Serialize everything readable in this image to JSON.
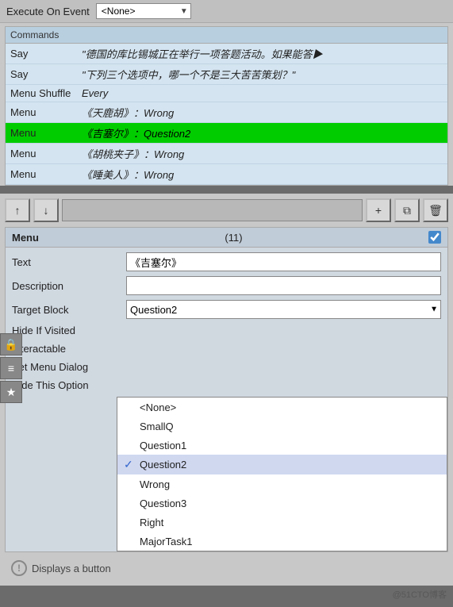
{
  "execute_on_event": {
    "label": "Execute On Event",
    "dropdown_value": "<None>",
    "dropdown_arrow": "▼"
  },
  "commands_panel": {
    "header": "Commands",
    "rows": [
      {
        "type": "Say",
        "value": "\"德国的库比锡城正在举行一项答题活动。如果能答▶",
        "selected": false
      },
      {
        "type": "Say",
        "value": "\"下列三个选项中，哪一个不是三大苦苦策划？\"",
        "selected": false
      },
      {
        "type": "Menu Shuffle",
        "value": "Every",
        "selected": false
      },
      {
        "type": "Menu",
        "value": "《天鹿胡》：Wrong",
        "selected": false
      },
      {
        "type": "Menu",
        "value": "《吉塞尔》：Question2",
        "selected": true
      },
      {
        "type": "Menu",
        "value": "《胡桃夹子》：Wrong",
        "selected": false
      },
      {
        "type": "Menu",
        "value": "《睡美人》：Wrong",
        "selected": false
      }
    ]
  },
  "toolbar": {
    "up_label": "↑",
    "down_label": "↓",
    "add_label": "+",
    "copy_label": "⧉",
    "delete_label": "🗑"
  },
  "menu_block": {
    "title": "Menu",
    "number": "(11)",
    "checkbox_checked": true,
    "properties": [
      {
        "label": "Text",
        "type": "text",
        "value": "《吉塞尔》"
      },
      {
        "label": "Description",
        "type": "text",
        "value": ""
      },
      {
        "label": "Target Block",
        "type": "dropdown",
        "value": "Question2"
      },
      {
        "label": "Hide If Visited",
        "type": "empty"
      },
      {
        "label": "Interactable",
        "type": "empty"
      },
      {
        "label": "Set Menu Dialog",
        "type": "empty"
      },
      {
        "label": "Hide This Option",
        "type": "empty"
      }
    ],
    "dropdown_options": [
      {
        "label": "<None>",
        "checked": false
      },
      {
        "label": "SmallQ",
        "checked": false
      },
      {
        "label": "Question1",
        "checked": false
      },
      {
        "label": "Question2",
        "checked": true
      },
      {
        "label": "Wrong",
        "checked": false
      },
      {
        "label": "Question3",
        "checked": false
      },
      {
        "label": "Right",
        "checked": false
      },
      {
        "label": "MajorTask1",
        "checked": false
      }
    ]
  },
  "displays_text": "Displays a button",
  "watermark": "@51CTO博客",
  "sidebar_icons": [
    "🔒",
    "≡",
    "★"
  ]
}
